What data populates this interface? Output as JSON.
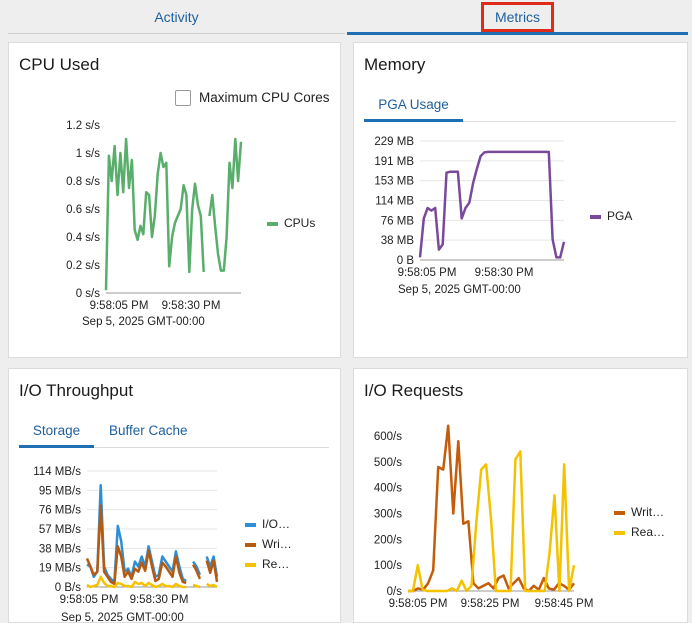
{
  "tabs": {
    "activity": "Activity",
    "metrics": "Metrics"
  },
  "cpu": {
    "title": "CPU Used",
    "max_cores_label": "Maximum CPU Cores",
    "chart_data": {
      "type": "line",
      "title": "",
      "yticks": [
        "1.2 s/s",
        "1 s/s",
        "0.8 s/s",
        "0.6 s/s",
        "0.4 s/s",
        "0.2 s/s",
        "0 s/s"
      ],
      "ylim": [
        0,
        1.2
      ],
      "xticks": [
        "9:58:05 PM",
        "9:58:30 PM"
      ],
      "date_label": "Sep 5, 2025 GMT-00:00",
      "legend_position": "right",
      "series": [
        {
          "name": "CPUs",
          "color": "#5aae6b",
          "values": [
            0.02,
            0.98,
            0.8,
            1.05,
            0.7,
            1.0,
            0.72,
            1.1,
            0.75,
            0.95,
            0.45,
            0.38,
            0.48,
            0.42,
            0.72,
            0.7,
            0.4,
            0.55,
            0.85,
            1.0,
            0.9,
            0.93,
            0.19,
            0.4,
            0.5,
            0.55,
            0.6,
            0.77,
            0.7,
            0.15,
            0.6,
            0.78,
            0.63,
            0.55,
            0.15,
            null,
            0.55,
            0.7,
            0.48,
            0.28,
            0.16,
            0.16,
            0.4,
            0.93,
            0.75,
            1.1,
            0.8,
            1.08
          ]
        }
      ]
    }
  },
  "memory": {
    "title": "Memory",
    "subtab": "PGA Usage",
    "chart_data": {
      "type": "line",
      "title": "",
      "yticks": [
        "229 MB",
        "191 MB",
        "153 MB",
        "114 MB",
        "76 MB",
        "38 MB",
        "0 B"
      ],
      "ylim": [
        0,
        229
      ],
      "xticks": [
        "9:58:05 PM",
        "9:58:30 PM"
      ],
      "date_label": "Sep 5, 2025 GMT-00:00",
      "legend_position": "right",
      "series": [
        {
          "name": "PGA",
          "color": "#7a4a9a",
          "values": [
            5,
            80,
            100,
            95,
            100,
            20,
            30,
            168,
            170,
            170,
            170,
            80,
            100,
            110,
            148,
            175,
            200,
            207,
            208,
            208,
            208,
            208,
            208,
            208,
            208,
            208,
            208,
            208,
            208,
            208,
            208,
            208,
            208,
            208,
            208,
            40,
            5,
            5,
            35
          ]
        }
      ]
    }
  },
  "io_throughput": {
    "title": "I/O Throughput",
    "subtabs": [
      "Storage",
      "Buffer Cache"
    ],
    "chart_data": {
      "type": "line",
      "title": "",
      "yticks": [
        "114 MB/s",
        "95 MB/s",
        "76 MB/s",
        "57 MB/s",
        "38 MB/s",
        "19 MB/s",
        "0 B/s"
      ],
      "ylim": [
        0,
        114
      ],
      "xticks": [
        "9:58:05 PM",
        "9:58:30 PM"
      ],
      "date_label": "Sep 5, 2025 GMT-00:00",
      "legend_position": "right",
      "series": [
        {
          "name": "I/O…",
          "color": "#2d8fd6",
          "values": [
            22,
            20,
            10,
            15,
            100,
            20,
            12,
            8,
            5,
            60,
            45,
            15,
            18,
            10,
            25,
            20,
            30,
            20,
            40,
            25,
            10,
            12,
            30,
            25,
            20,
            15,
            35,
            20,
            8,
            6,
            null,
            25,
            20,
            12,
            null,
            30,
            20,
            30,
            10
          ]
        },
        {
          "name": "Wri…",
          "color": "#b85a0e",
          "values": [
            28,
            20,
            12,
            15,
            80,
            15,
            10,
            5,
            3,
            40,
            30,
            10,
            15,
            8,
            18,
            15,
            24,
            16,
            36,
            20,
            6,
            8,
            24,
            20,
            15,
            10,
            30,
            14,
            5,
            4,
            null,
            22,
            16,
            8,
            null,
            26,
            14,
            26,
            5
          ]
        },
        {
          "name": "Re…",
          "color": "#f5c200",
          "values": [
            2,
            0,
            1,
            2,
            10,
            4,
            1,
            1,
            0,
            4,
            3,
            1,
            1,
            0,
            5,
            3,
            4,
            1,
            4,
            2,
            0,
            1,
            3,
            1,
            1,
            0,
            3,
            1,
            0,
            0,
            null,
            2,
            1,
            0,
            null,
            3,
            1,
            2,
            0
          ]
        }
      ]
    }
  },
  "io_requests": {
    "title": "I/O Requests",
    "chart_data": {
      "type": "line",
      "title": "",
      "yticks": [
        "600/s",
        "500/s",
        "400/s",
        "300/s",
        "200/s",
        "100/s",
        "0/s"
      ],
      "ylim": [
        0,
        600
      ],
      "xticks": [
        "9:58:05 PM",
        "9:58:25 PM",
        "9:58:45 PM"
      ],
      "date_label": "",
      "legend_position": "right",
      "series": [
        {
          "name": "Writ…",
          "color": "#c45c0a",
          "values": [
            0,
            0,
            10,
            5,
            30,
            80,
            480,
            470,
            640,
            300,
            580,
            260,
            270,
            30,
            10,
            20,
            30,
            10,
            50,
            60,
            10,
            30,
            50,
            10,
            0,
            20,
            5,
            50,
            10,
            5,
            30,
            20,
            5,
            30
          ]
        },
        {
          "name": "Rea…",
          "color": "#f5c200",
          "values": [
            0,
            0,
            100,
            5,
            0,
            0,
            0,
            0,
            0,
            10,
            0,
            40,
            0,
            20,
            270,
            470,
            490,
            280,
            0,
            0,
            0,
            0,
            510,
            540,
            0,
            0,
            0,
            0,
            0,
            150,
            370,
            0,
            490,
            0,
            100
          ]
        }
      ]
    }
  },
  "colors": {
    "accent": "#1e6fb3",
    "highlight": "#e02a1a"
  }
}
